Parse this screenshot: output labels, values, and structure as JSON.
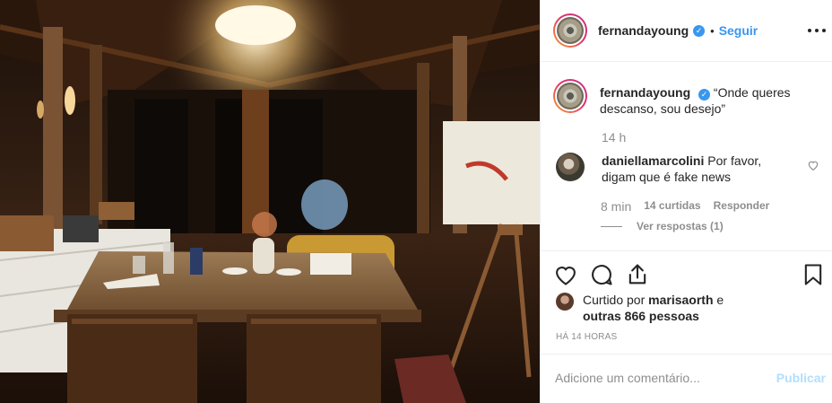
{
  "post": {
    "username": "fernandayoung",
    "verified_badge": "✓",
    "separator": "•",
    "follow_label": "Seguir",
    "more_icon": "more-options-icon"
  },
  "caption": {
    "username": "fernandayoung",
    "text": "“Onde queres descanso, sou desejo”",
    "time": "14 h"
  },
  "comment": {
    "username": "daniellamarcolini",
    "text": "Por favor, digam que é fake news",
    "time": "8 min",
    "likes": "14 curtidas",
    "reply_label": "Responder",
    "see_replies": "Ver respostas (1)"
  },
  "actions": {
    "like_icon": "heart-icon",
    "comment_icon": "comment-icon",
    "share_icon": "share-icon",
    "save_icon": "bookmark-icon"
  },
  "likes": {
    "prefix": "Curtido por",
    "user": "marisaorth",
    "conj": "e",
    "others": "outras 866 pessoas"
  },
  "post_time": "HÁ 14 HORAS",
  "comment_box": {
    "placeholder": "Adicione um comentário...",
    "publish_label": "Publicar"
  },
  "colors": {
    "accent": "#3897f0",
    "publish_disabled": "#b2dffc",
    "muted": "#8e8e8e"
  }
}
